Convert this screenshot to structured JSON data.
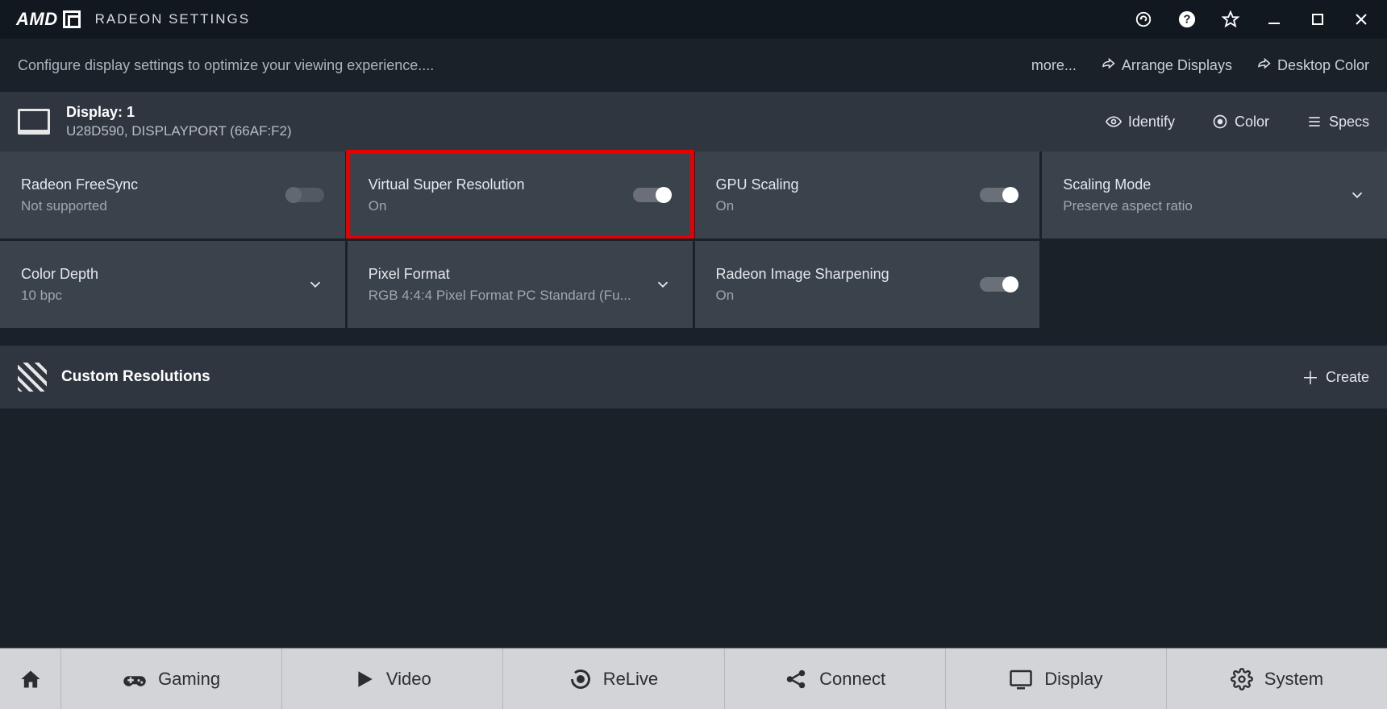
{
  "titlebar": {
    "brand": "AMD",
    "title": "RADEON SETTINGS"
  },
  "subheader": {
    "description": "Configure display settings to optimize your viewing experience....",
    "more": "more...",
    "arrange": "Arrange Displays",
    "desktop_color": "Desktop Color"
  },
  "display": {
    "label": "Display: 1",
    "port": "U28D590, DISPLAYPORT (66AF:F2)",
    "identify": "Identify",
    "color": "Color",
    "specs": "Specs"
  },
  "tiles": {
    "freesync": {
      "title": "Radeon FreeSync",
      "value": "Not supported",
      "state": "off",
      "disabled": true
    },
    "vsr": {
      "title": "Virtual Super Resolution",
      "value": "On",
      "state": "on",
      "highlight": true
    },
    "gpuscale": {
      "title": "GPU Scaling",
      "value": "On",
      "state": "on"
    },
    "scalemode": {
      "title": "Scaling Mode",
      "value": "Preserve aspect ratio"
    },
    "colordepth": {
      "title": "Color Depth",
      "value": "10 bpc"
    },
    "pixfmt": {
      "title": "Pixel Format",
      "value": "RGB 4:4:4 Pixel Format PC Standard (Fu..."
    },
    "sharpen": {
      "title": "Radeon Image Sharpening",
      "value": "On",
      "state": "on"
    }
  },
  "custom": {
    "label": "Custom Resolutions",
    "create": "Create"
  },
  "nav": {
    "gaming": "Gaming",
    "video": "Video",
    "relive": "ReLive",
    "connect": "Connect",
    "display": "Display",
    "system": "System"
  }
}
